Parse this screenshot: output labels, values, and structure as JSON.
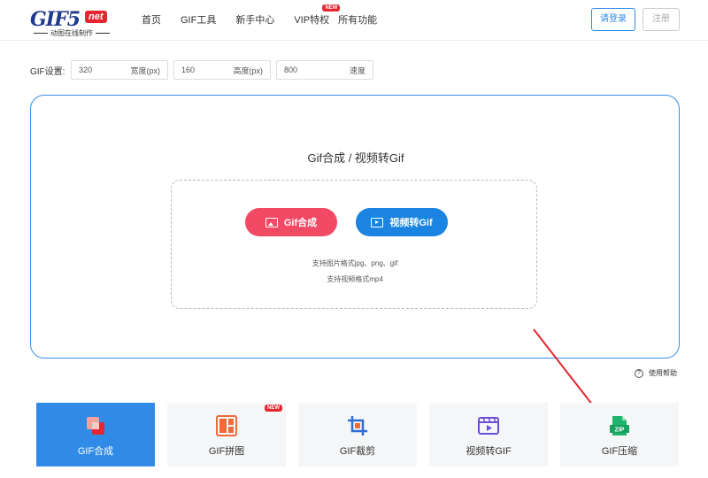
{
  "header": {
    "logo_main": "GIF5",
    "logo_badge": "net",
    "logo_sub": "动图在线制作",
    "nav": [
      {
        "label": "首页"
      },
      {
        "label": "GIF工具"
      },
      {
        "label": "新手中心"
      },
      {
        "label": "VIP特权",
        "badge": "NEW"
      },
      {
        "label": "所有功能"
      }
    ],
    "login_label": "请登录",
    "register_label": "注册"
  },
  "settings": {
    "label": "GIF设置:",
    "width": {
      "value": "320",
      "unit": "宽度(px)"
    },
    "height": {
      "value": "160",
      "unit": "高度(px)"
    },
    "speed": {
      "value": "800",
      "unit": "速度"
    }
  },
  "upload": {
    "title": "Gif合成 / 视频转Gif",
    "merge_button": "Gif合成",
    "video_button": "视频转Gif",
    "hint_images": "支持图片格式jpg、png、gif",
    "hint_video": "支持视频格式mp4"
  },
  "help_label": "使用帮助",
  "tools": [
    {
      "label": "GIF合成",
      "icon": "merge-icon",
      "active": true
    },
    {
      "label": "GIF拼图",
      "icon": "collage-icon",
      "badge": "NEW"
    },
    {
      "label": "GIF裁剪",
      "icon": "crop-icon"
    },
    {
      "label": "视频转GIF",
      "icon": "video-icon"
    },
    {
      "label": "GIF压缩",
      "icon": "zip-icon"
    }
  ],
  "colors": {
    "accent_blue": "#2f8be6",
    "merge_red": "#f24a64",
    "video_blue": "#1a84e0",
    "badge_red": "#e3262f"
  }
}
